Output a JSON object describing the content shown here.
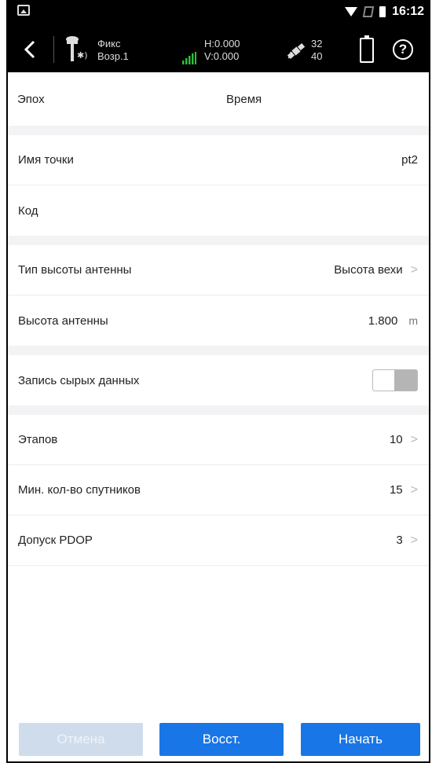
{
  "status_bar": {
    "time": "16:12"
  },
  "toolbar": {
    "fix_status": "Фикс",
    "age": "Возр.1",
    "h_precision": "H:0.000",
    "v_precision": "V:0.000",
    "sats_used": "32",
    "sats_visible": "40"
  },
  "epoch": {
    "label": "Эпох",
    "time_label": "Время"
  },
  "form": {
    "point_name": {
      "label": "Имя точки",
      "value": "pt2"
    },
    "code": {
      "label": "Код",
      "value": ""
    },
    "antenna_height_type": {
      "label": "Тип высоты антенны",
      "value": "Высота вехи"
    },
    "antenna_height": {
      "label": "Высота антенны",
      "value": "1.800",
      "unit": "m"
    },
    "raw_data": {
      "label": "Запись сырых данных",
      "enabled": false
    },
    "epochs": {
      "label": "Этапов",
      "value": "10"
    },
    "min_sats": {
      "label": "Мин. кол-во спутников",
      "value": "15"
    },
    "pdop": {
      "label": "Допуск PDOP",
      "value": "3"
    }
  },
  "buttons": {
    "cancel": "Отмена",
    "reset": "Восст.",
    "start": "Начать"
  },
  "colors": {
    "accent": "#1976e6",
    "disabled": "#cfdcec",
    "signal": "#2fbf3a"
  }
}
